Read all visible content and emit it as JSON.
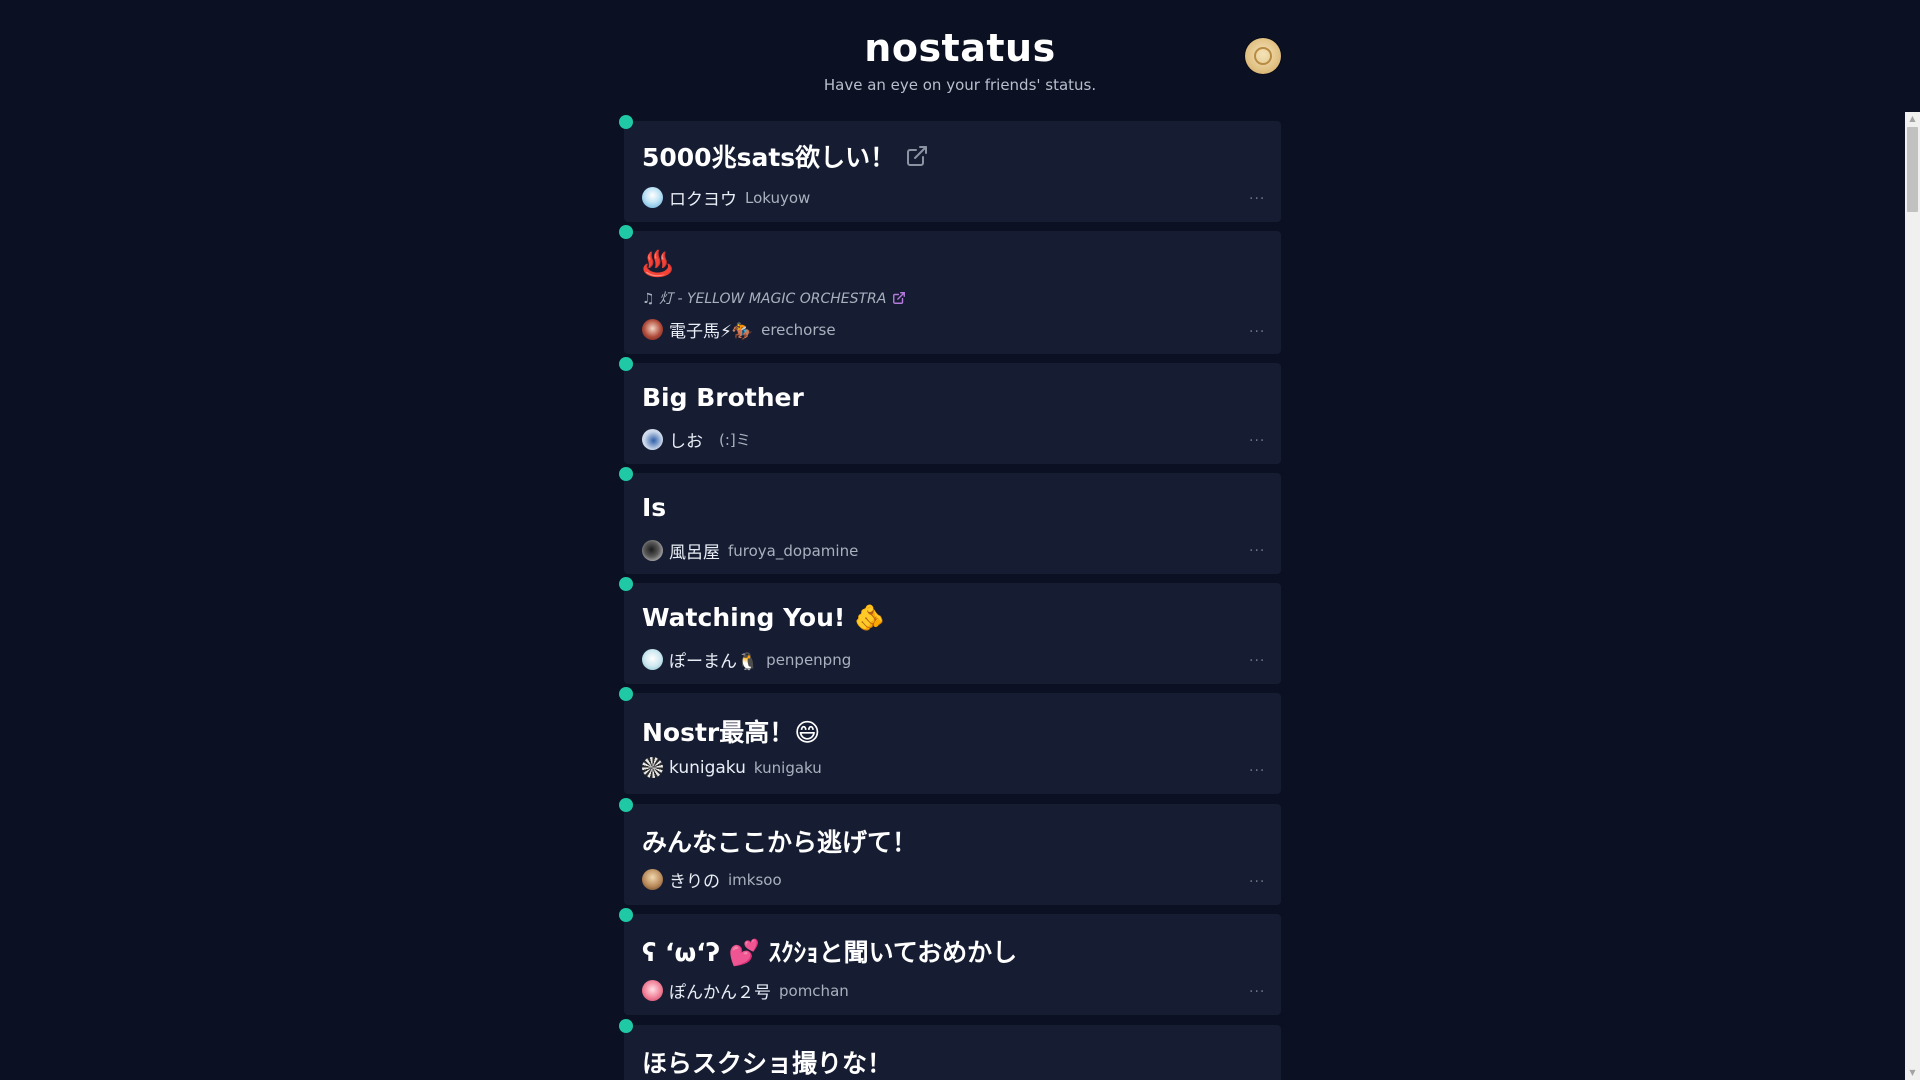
{
  "header": {
    "title": "nostatus",
    "subtitle": "Have an eye on your friends' status."
  },
  "colors": {
    "background": "#0b1022",
    "card": "#161d32",
    "online_dot": "#20c9a6",
    "link": "#b57bdc"
  },
  "statuses": [
    {
      "status": "5000兆sats欲しい！",
      "has_link": true,
      "display_name": "ロクヨウ",
      "handle": "Lokuyow"
    },
    {
      "status": "♨️",
      "music": "♫ 灯 - YELLOW MAGIC ORCHESTRA",
      "display_name": "電子馬⚡🏇",
      "handle": "erechorse"
    },
    {
      "status": "Big Brother",
      "display_name": "しお",
      "handle": "(:]ミ"
    },
    {
      "status": "Is",
      "display_name": "風呂屋",
      "handle": "furoya_dopamine"
    },
    {
      "status": "Watching You! 🫵",
      "display_name": "ぽーまん🐧",
      "handle": "penpenpng"
    },
    {
      "status": "Nostr最高！😄",
      "display_name": "kunigaku",
      "handle": "kunigaku"
    },
    {
      "status": "みんなここから逃げて！",
      "display_name": "きりの",
      "handle": "imksoo"
    },
    {
      "status": "ʕ ʻωʻʔ 💕 ｽｸｼｮと聞いておめかし",
      "display_name": "ぽんかん２号",
      "handle": "pomchan"
    },
    {
      "status": "ほらスクショ撮りな！"
    }
  ],
  "more_label": "···"
}
